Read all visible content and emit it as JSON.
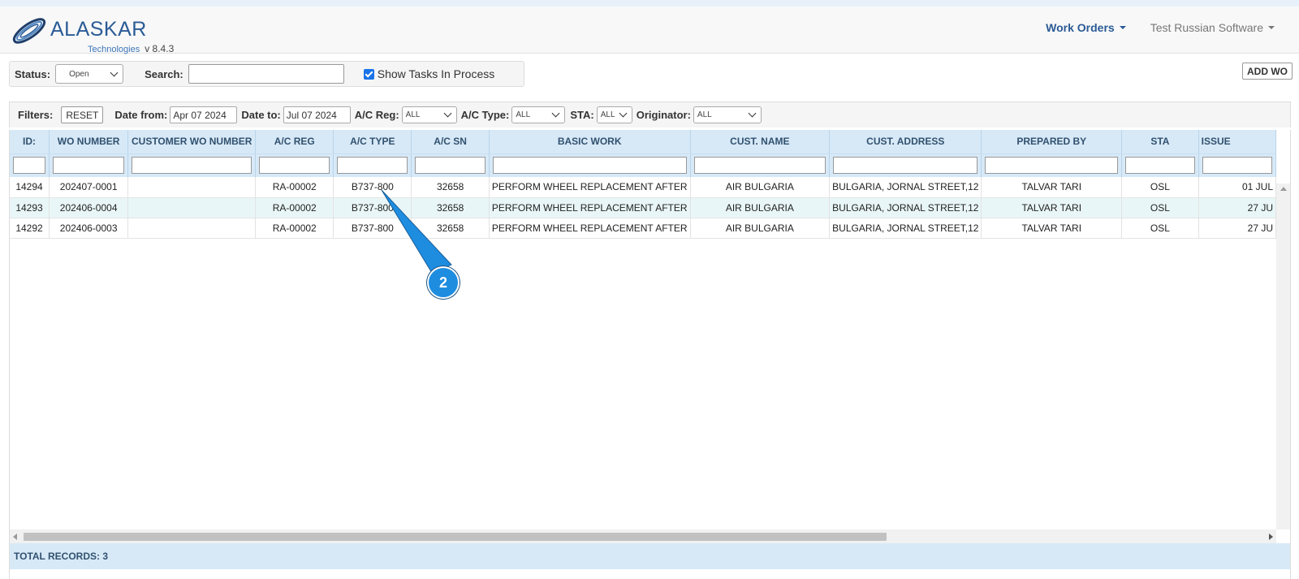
{
  "app": {
    "brand_name": "ALASKAR",
    "brand_sub": "Technologies",
    "version": "v 8.4.3"
  },
  "nav": {
    "work_orders": "Work Orders",
    "account": "Test Russian Software"
  },
  "status_bar": {
    "status_label": "Status:",
    "status_value": "Open",
    "search_label": "Search:",
    "search_value": "",
    "show_tasks_label": "Show Tasks In Process",
    "show_tasks_checked": true
  },
  "add_wo_label": "ADD WO",
  "filters": {
    "filters_label": "Filters:",
    "reset_label": "RESET",
    "date_from_label": "Date from:",
    "date_from_value": "Apr 07 2024",
    "date_to_label": "Date to:",
    "date_to_value": "Jul 07 2024",
    "ac_reg_label": "A/C Reg:",
    "ac_reg_value": "ALL",
    "ac_type_label": "A/C Type:",
    "ac_type_value": "ALL",
    "sta_label": "STA:",
    "sta_value": "ALL",
    "originator_label": "Originator:",
    "originator_value": "ALL"
  },
  "table": {
    "columns": [
      "ID:",
      "WO NUMBER",
      "CUSTOMER WO NUMBER",
      "A/C REG",
      "A/C TYPE",
      "A/C SN",
      "BASIC WORK",
      "CUST. NAME",
      "CUST. ADDRESS",
      "PREPARED BY",
      "STA",
      "ISSUE"
    ],
    "rows": [
      [
        "14294",
        "202407-0001",
        "",
        "RA-00002",
        "B737-800",
        "32658",
        "PERFORM WHEEL REPLACEMENT AFTER",
        "AIR BULGARIA",
        "BULGARIA, JORNAL STREET,12",
        "TALVAR TARI",
        "OSL",
        "01 JUL"
      ],
      [
        "14293",
        "202406-0004",
        "",
        "RA-00002",
        "B737-800",
        "32658",
        "PERFORM WHEEL REPLACEMENT AFTER",
        "AIR BULGARIA",
        "BULGARIA, JORNAL STREET,12",
        "TALVAR TARI",
        "OSL",
        "27 JU"
      ],
      [
        "14292",
        "202406-0003",
        "",
        "RA-00002",
        "B737-800",
        "32658",
        "PERFORM WHEEL REPLACEMENT AFTER",
        "AIR BULGARIA",
        "BULGARIA, JORNAL STREET,12",
        "TALVAR TARI",
        "OSL",
        "27 JU"
      ]
    ]
  },
  "footer": {
    "total_records": "TOTAL RECORDS: 3"
  },
  "callout": {
    "number": "2",
    "color": "#1e8de0"
  },
  "colors": {
    "header_bg": "#d7e9f7",
    "header_text": "#31516f",
    "alt_row": "#e9f6f7",
    "brand": "#2a5b96"
  }
}
